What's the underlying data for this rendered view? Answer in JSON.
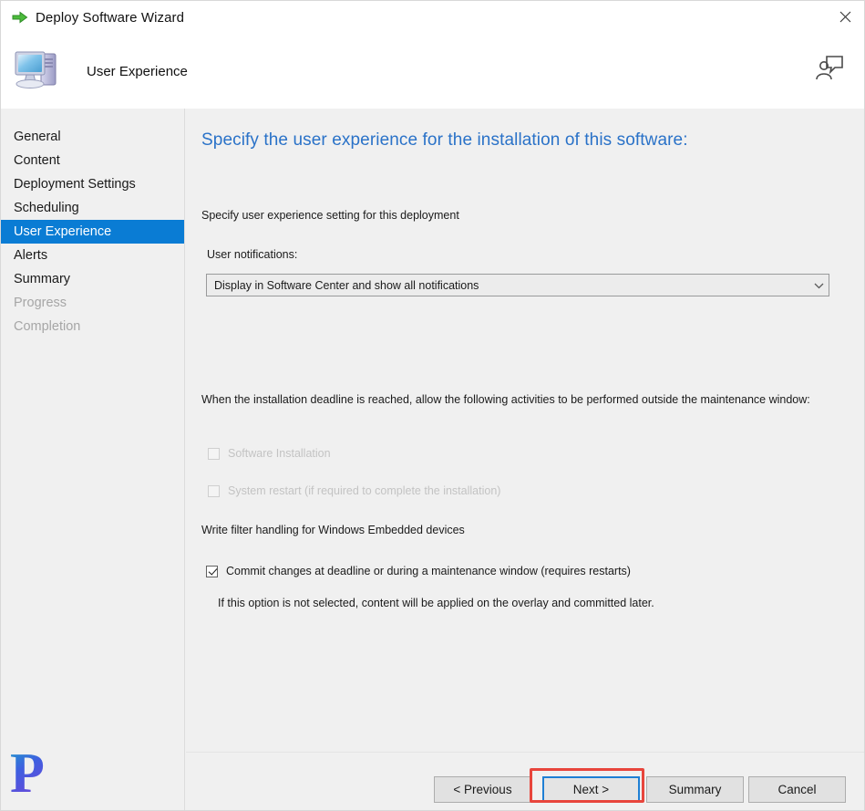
{
  "window": {
    "title": "Deploy Software Wizard",
    "title_icon": "green-arrow-icon",
    "close_label": "✕"
  },
  "header": {
    "title": "User Experience",
    "icon": "computer-icon",
    "help_icon": "person-speech-bubble-icon"
  },
  "sidebar": {
    "items": [
      {
        "label": "General",
        "state": "normal"
      },
      {
        "label": "Content",
        "state": "normal"
      },
      {
        "label": "Deployment Settings",
        "state": "normal"
      },
      {
        "label": "Scheduling",
        "state": "normal"
      },
      {
        "label": "User Experience",
        "state": "selected"
      },
      {
        "label": "Alerts",
        "state": "normal"
      },
      {
        "label": "Summary",
        "state": "normal"
      },
      {
        "label": "Progress",
        "state": "disabled"
      },
      {
        "label": "Completion",
        "state": "disabled"
      }
    ]
  },
  "content": {
    "page_title": "Specify the user experience for the installation of this software:",
    "subtitle": "Specify user experience setting for this deployment",
    "notifications_label": "User notifications:",
    "notifications_value": "Display in Software Center and show all notifications",
    "notifications_arrow": "chevron-down-icon",
    "deadline_paragraph": "When the installation deadline is reached, allow the following activities to be performed outside the maintenance window:",
    "checkbox_software_installation": "Software Installation",
    "checkbox_system_restart": "System restart  (if required to complete the installation)",
    "write_filter_label": "Write filter handling for Windows Embedded devices",
    "checkbox_commit_changes": "Commit changes at deadline or during a maintenance window (requires restarts)",
    "commit_note": "If this option is not selected, content will be applied on the overlay and committed later."
  },
  "footer": {
    "previous_label": "< Previous",
    "next_label": "Next >",
    "summary_label": "Summary",
    "cancel_label": "Cancel"
  },
  "colors": {
    "accent_blue": "#0a7cd4",
    "title_blue": "#2a72c8",
    "focus_blue": "#1f7fd4",
    "annotation_red": "#e8453c",
    "disabled_gray": "#a6a6a6"
  }
}
